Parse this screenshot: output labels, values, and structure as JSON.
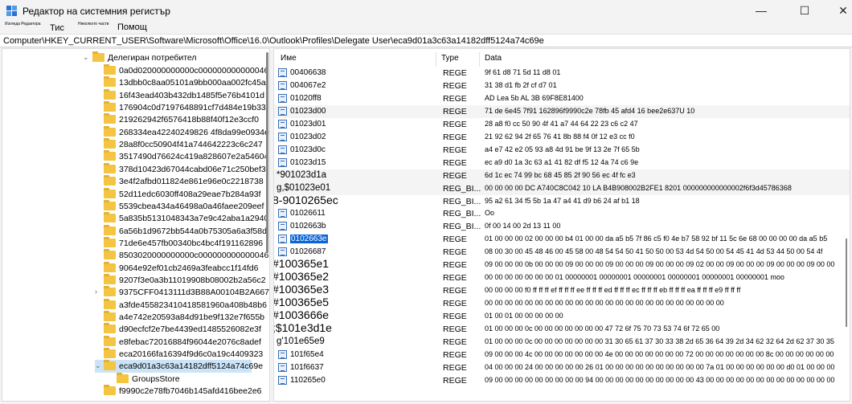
{
  "window": {
    "title": "Редактор на системния регистър",
    "minimize": "—",
    "maximize": "☐",
    "close": "✕"
  },
  "menu": [
    "Изгледа Редактора",
    "Тис",
    "Няколкото части",
    "Помощ"
  ],
  "address": "Computer\\HKEY_CURRENT_USER\\Software\\Microsoft\\Office\\16.0\\Outlook\\Profiles\\Delegate User\\eca9d01a3c63a14182dff5124a74c69e",
  "tree": {
    "parent": "Делегиран потребител",
    "items": [
      {
        "label": "0a0d020000000000c000000000000046"
      },
      {
        "label": "13dbb0c8aa05101a9bb000aa002fc45a"
      },
      {
        "label": "16f43ead403b432db1485f5e76b4101d"
      },
      {
        "label": "176904c0d7197648891cf7d484e19b33"
      },
      {
        "label": "219262942f6576418b88f40f12e3ccf0"
      },
      {
        "label": "268334ea42240249826 4f8da99e0934e"
      },
      {
        "label": "28a8f0cc50904f41a744642223c6c247"
      },
      {
        "label": "3517490d76624c419a828607e2a54604"
      },
      {
        "label": "378d10423d67044cabd06e71c250bef3"
      },
      {
        "label": "3e4f2afbd011824e861e96e0c2218738"
      },
      {
        "label": "52d11edc6030ff408a29eae7b284a93f"
      },
      {
        "label": "5539cbea434a46498a0a46faee209eef"
      },
      {
        "label": "5a835b5131048343a7e9c42aba1a2940"
      },
      {
        "label": "6a56b1d9672bb544a0b75305a6a3f58d"
      },
      {
        "label": "71de6e457fb00340bc4bc4f191162896"
      },
      {
        "label": "8503020000000000c000000000000046"
      },
      {
        "label": "9064e92ef01cb2469a3feabcc1f14fd6"
      },
      {
        "label": "9207f3e0a3b11019908b08002b2a56c2"
      },
      {
        "label": "9375CFF0413111d3B88A00104B2A6676",
        "chevron": "›"
      },
      {
        "label": "a3fde455823410418581960a408b48b6"
      },
      {
        "label": "a4e742e20593a84d91be9f132e7f655b"
      },
      {
        "label": "d90ecfcf2e7be4439ed1485526082e3f"
      },
      {
        "label": "e8febac72016884f96044e2076c8adef"
      },
      {
        "label": "eca20166fa16394f9d6c0a19c4409323"
      },
      {
        "label": "eca9d01a3c63a14182dff5124a74c69e",
        "chevron": "⌄",
        "selected": true
      },
      {
        "label": "GroupsStore",
        "child": true
      },
      {
        "label": "f9990c2e78fb7046b145afd416bee2e6"
      }
    ]
  },
  "list": {
    "headers": {
      "name": "Име",
      "type": "Type",
      "data": "Data"
    },
    "rows": [
      {
        "name": "00406638",
        "type": "REGE",
        "data": "9f 61 d8 71 5d 11 d8 01"
      },
      {
        "name": "004067e2",
        "type": "REGE",
        "data": "31 38 d1 fb 2f cf d7 01"
      },
      {
        "name": "01020ff8",
        "type": "REGE",
        "data": "AD Lea 5b AL 3B 69F8E81400"
      },
      {
        "name": "01023d00",
        "type": "REGE",
        "data": "71 de 6e45 7f91 162896f9990c2e 78fb 45 afd4 16 bee2e637U 10"
      },
      {
        "name": "01023d01",
        "type": "REGE",
        "data": "28 a8 f0 cc 50 90 4f 41 a7 44 64 22 23 c6 c2 47"
      },
      {
        "name": "01023d02",
        "type": "REGE",
        "data": "21 92 62 94 2f 65 76 41 8b 88 f4 0f 12 e3 cc f0"
      },
      {
        "name": "01023d0c",
        "type": "REGE",
        "data": "a4 e7 42 e2 05 93 a8 4d 91 be 9f 13 2e 7f 65 5b"
      },
      {
        "name": "01023d15",
        "type": "REGE",
        "data": "ec a9 d0 1a 3c 63 a1 41 82 df f5 12 4a 74 c6 9e"
      },
      {
        "name": "*901023d1a",
        "type": "REGE",
        "data": "6d 1c ec 74 99 bc 68 45 85 2f 90 56 ec 4f fc e3",
        "style": "mid"
      },
      {
        "name": "g,$01023e01",
        "type": "REG_BI...",
        "data": "00 00 00 00 DC A740C8C042 10 LA B4B908002B2FE1 8201 000000000000002f6f3d45786368",
        "style": "mid"
      },
      {
        "name": "8-9010265ec",
        "type": "REG_BI...",
        "data": "95 a2 61 34 f5 5b 1a 47 a4 41 d9 b6 24 af b1 18",
        "style": "big"
      },
      {
        "name": "01026611",
        "type": "REG_BI...",
        "data": "Oo"
      },
      {
        "name": "0102663b",
        "type": "REG_BI...",
        "data": "0f 00 14 00 2d 13 11 00"
      },
      {
        "name": "0102663e",
        "type": "REGE",
        "data": "01 00 00 00 02 00 00 00 b4 01 00 00 da a5 b5 7f 86 c5 f0 4e b7 58 92 bf 11 5c 6e 68 00 00 00 00 da a5 b5",
        "selected": true
      },
      {
        "name": "01026687",
        "type": "REGE",
        "data": "08 00 30 00 45 48 46 00 45 58 00 48 54 54 50 41 50 50 00 53 4d 54 50 00 54 45 41 4d 53 44 50 00 54 4f"
      },
      {
        "name": "#100365e1",
        "type": "REGE",
        "data": "09 00 00 00 0b 00 00 00 09 00 00 00 09 00 00 00 09 00 00 00 09 02 00 00 09 00 00 00 09 00 00 00 09 00 00",
        "style": "big"
      },
      {
        "name": "#100365e2",
        "type": "REGE",
        "data": "00 00 00 00 00 00 00 01 00000001 00000001 00000001 00000001 00000001 00000001 moo",
        "style": "big"
      },
      {
        "name": "#100365e3",
        "type": "REGE",
        "data": "00 00 00 00 f0 ff ff ff ef ff ff ff ee ff ff ff ed ff ff ff ec ff ff ff eb ff ff ff ea ff ff ff e9 ff ff ff",
        "style": "big"
      },
      {
        "name": "#100365e5",
        "type": "REGE",
        "data": "00 00 00 00 00 00 00 00 00 00 00 00 00 00 00 00 00 00 00 00 00 00 00 00",
        "style": "big"
      },
      {
        "name": "#1003666e",
        "type": "REGE",
        "data": "01 00 01 00 00 00 00 00",
        "style": "big"
      },
      {
        "name": ";$101e3d1e",
        "type": "REGE",
        "data": "01 00 00 00 0c 00 00 00 00 00 00 00 47 72 6f 75 70 73 53 74 6f 72 65 00",
        "style": "big"
      },
      {
        "name": "g'101e65e9",
        "type": "REGE",
        "data": "01 00 00 00 0c 00 00 00 00 00 00 00 31 30 65 61 37 30 33 38 2d 65 36 64 39 2d 34 62 32 64 2d 62 37 30 35",
        "style": "mid"
      },
      {
        "name": "101f65e4",
        "type": "REGE",
        "data": "09 00 00 00 4c 00 00 00 00 00 00 00 4e 00 00 00 00 00 00 00 72 00 00 00 00 00 00 00 8c 00 00 00 00 00 00"
      },
      {
        "name": "101f6637",
        "type": "REGE",
        "data": "04 00 00 00 24 00 00 00 00 00 26 01 00 00 00 00 00 00 00 00 00 00 7a 01 00 00 00 00 00 00 d0 01 00 00 00"
      },
      {
        "name": "110265e0",
        "type": "REGE",
        "data": "09 00 00 00 00 00 00 00 00 00 94 00 00 00 00 00 00 00 00 00 00 43 00 00 00 00 00 00 00 00 00 00 00 00 00"
      }
    ]
  }
}
